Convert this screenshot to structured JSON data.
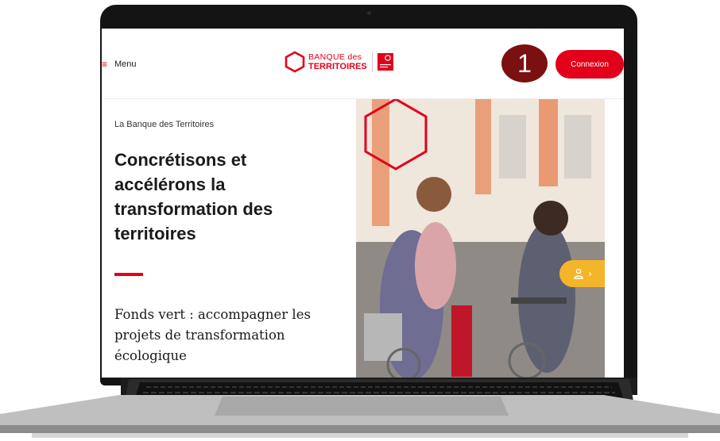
{
  "header": {
    "menu_icon": "≡",
    "menu_label": "Menu",
    "logo": {
      "line1": "BANQUE des",
      "line2": "TERRITOIRES"
    },
    "callout_number": "1",
    "connexion_label": "Connexion"
  },
  "hero": {
    "eyebrow": "La Banque des Territoires",
    "title": "Concrétisons et accélérons la transformation des territoires",
    "subtitle": "Fonds vert : accompagner les projets de transformation écologique"
  },
  "side_button": {
    "icon": "user-icon",
    "chevron": "›"
  },
  "colors": {
    "brand_red": "#e2001a",
    "callout": "#7a1010",
    "side_button": "#f5b52a"
  }
}
